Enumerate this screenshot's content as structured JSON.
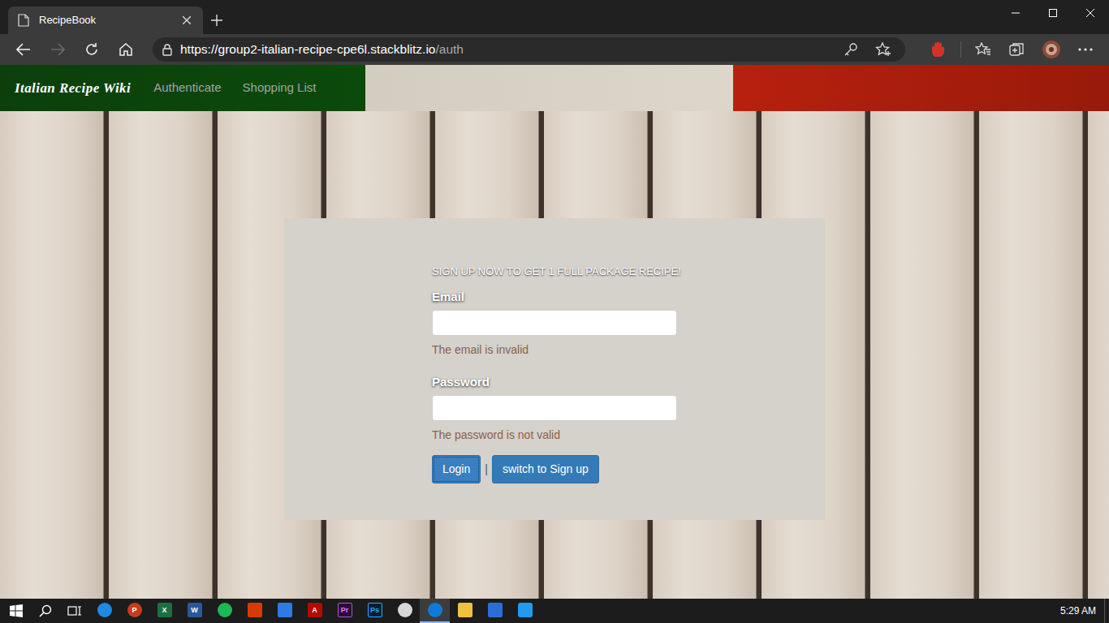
{
  "window": {
    "tabs": [
      {
        "label": "RecipeBook",
        "selected": true
      }
    ]
  },
  "toolbar": {
    "back_enabled": true,
    "forward_enabled": false,
    "url_host": "https://group2-italian-recipe-cpe6l.stackblitz.io",
    "url_path": "/auth"
  },
  "navbar": {
    "brand": "Italian Recipe Wiki",
    "links": [
      {
        "label": "Authenticate",
        "selected": false
      },
      {
        "label": "Shopping List",
        "selected": false
      }
    ]
  },
  "form": {
    "heading": "SIGN UP NOW TO GET 1 FULL PACKAGE RECIPE!",
    "fields": [
      {
        "label": "Email",
        "value": "",
        "error": "The email is invalid"
      },
      {
        "label": "Password",
        "value": "",
        "error": "The password is not valid"
      }
    ],
    "buttons": [
      {
        "label": "Login",
        "focused": true
      },
      {
        "label": "switch to Sign up",
        "focused": false
      }
    ],
    "separator": "|"
  },
  "taskbar": {
    "apps": [
      {
        "selected": false
      },
      {
        "glyph": "P",
        "selected": false
      },
      {
        "glyph": "X",
        "selected": false
      },
      {
        "glyph": "W",
        "selected": false
      },
      {
        "selected": false
      },
      {
        "selected": false
      },
      {
        "selected": false
      },
      {
        "glyph": "A",
        "selected": false
      },
      {
        "glyph": "Pr",
        "selected": false
      },
      {
        "glyph": "Ps",
        "selected": false
      },
      {
        "selected": false
      },
      {
        "selected": true
      },
      {
        "selected": false
      },
      {
        "selected": false
      },
      {
        "selected": false
      }
    ],
    "time": "5:29 AM"
  }
}
